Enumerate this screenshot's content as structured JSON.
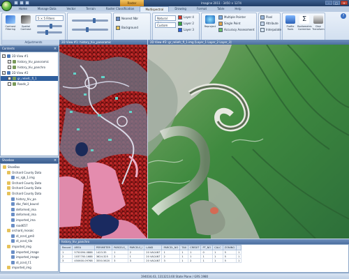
{
  "titlebar": {
    "context_tab": "Raster",
    "window_title": "Imagine 2011 - 3450 × 1274"
  },
  "tabs": [
    "Home",
    "Manage Data",
    "Vector",
    "Terrain",
    "Raster Classification",
    "Multispectral",
    "Drawing",
    "Format",
    "Table",
    "Help"
  ],
  "active_tab": "Multispectral",
  "ribbon": {
    "contrast_group": {
      "label": "Adjustments",
      "buttons": [
        "Contrast Filtering",
        "Spatial Contrast"
      ],
      "mode_value": "5 × 5 Filters",
      "brightness_label": "Brightness",
      "contrast_label": "Contrast"
    },
    "sharpness_group": {
      "label": "Brightness / Contrast"
    },
    "view_group": {
      "label": "View",
      "items": [
        "Nearest Nbr",
        "Background"
      ]
    },
    "bands_group": {
      "label": "Bands",
      "combo1": "Natural Colour",
      "combo2": "Custom",
      "layers": [
        "Layer 4",
        "Layer 2",
        "Layer 3"
      ],
      "layer_colors": [
        "#d93a2b",
        "#3aa33a",
        "#2b5fd9"
      ]
    },
    "enhance_group": {
      "label": "Enhancement",
      "buttons": [
        "Reproject"
      ],
      "items": [
        "Multiple Pointer",
        "Single Point",
        "Accuracy Assessment"
      ]
    },
    "utilities_group": {
      "label": "Utilities",
      "items": [
        "Pixel",
        "Attribute",
        "Interpolate"
      ]
    },
    "tools_group": {
      "label": "Tools",
      "buttons": [
        "Profile Tools",
        "Radiometric Correction",
        "Disk Transform"
      ]
    }
  },
  "contents_pane": {
    "title": "Contents",
    "rows": [
      {
        "label": "2D View #1",
        "checked": true,
        "selected": false
      },
      {
        "label": "history_hiv_panoramic",
        "checked": true,
        "selected": false
      },
      {
        "label": "history_hiv_panchro",
        "checked": false,
        "selected": false
      },
      {
        "label": "2D View #2",
        "checked": true,
        "selected": false
      },
      {
        "label": "gr_reliefc_fl_1",
        "checked": true,
        "selected": true
      },
      {
        "label": "Roads_2",
        "checked": false,
        "selected": false
      }
    ]
  },
  "shoebox_pane": {
    "title": "Shoebox",
    "rows": [
      {
        "label": "ShoeBox",
        "indent": 0
      },
      {
        "label": "Orchard County Data",
        "indent": 1
      },
      {
        "label": "ec_rgb_1.img",
        "indent": 2
      },
      {
        "label": "Orchard County Data",
        "indent": 1
      },
      {
        "label": "Orchard County Data",
        "indent": 1
      },
      {
        "label": "Orchard County Data",
        "indent": 1
      },
      {
        "label": "history_hiv_pa",
        "indent": 2
      },
      {
        "label": "dbc_field_bound",
        "indent": 2
      },
      {
        "label": "deformed_ima",
        "indent": 2
      },
      {
        "label": "deformed_ima",
        "indent": 2
      },
      {
        "label": "imported_ima",
        "indent": 2
      },
      {
        "label": "road657",
        "indent": 2
      },
      {
        "label": "orchard_mosaic",
        "indent": 1
      },
      {
        "label": "dl_zcnd_gm0",
        "indent": 2
      },
      {
        "label": "dl_zcnd_tile",
        "indent": 2
      },
      {
        "label": "imported_img",
        "indent": 1
      },
      {
        "label": "imported_image",
        "indent": 2
      },
      {
        "label": "imported_image",
        "indent": 2
      },
      {
        "label": "dl_zcnd_f.1",
        "indent": 2
      },
      {
        "label": "imported_img",
        "indent": 1
      }
    ]
  },
  "views": {
    "left_title": "2D View #1: history_hiv_panoramic",
    "right_title": "2D View #2: gr_reliefc_fl_1.img [Layer_1 Layer_2 Layer_3]"
  },
  "attribute_table": {
    "title": "history_hiv_panchro",
    "columns": [
      "Record",
      "AREA",
      "PERIMETER",
      "PARCELS_",
      "PARCELS_I",
      "LAND",
      "PARCEL_NO",
      "TAX",
      "CREDIT",
      "PT_NO",
      "CALC",
      "ZONING",
      ""
    ],
    "rows": [
      [
        "1",
        "5750094.0888",
        "1423.35",
        "1",
        "2",
        "20 VACANT",
        "1",
        "1",
        "1",
        "0",
        "1",
        "5",
        "1"
      ],
      [
        "2",
        "1037700.1688",
        "3624.325",
        "2",
        "1",
        "20 VACANT",
        "2",
        "1",
        "1",
        "1",
        "1",
        "5",
        "1"
      ],
      [
        "3",
        "450600.09768",
        "3550.5620",
        "3",
        "3",
        "20 VACANT",
        "3",
        "1",
        "2",
        "1",
        "1",
        "5",
        "1"
      ]
    ]
  },
  "status": {
    "text": "194034.43, 1313213.60  State Plane / GRS 1980"
  }
}
